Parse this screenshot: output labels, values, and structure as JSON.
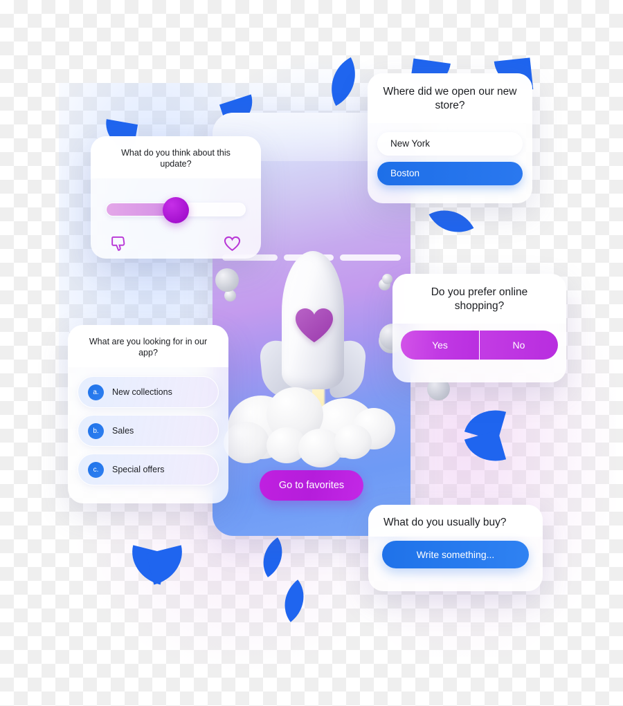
{
  "survey_cards": {
    "slider_card": {
      "question": "What do you think about this update?",
      "slider_value_percent": 50,
      "left_icon": "thumbs-down-icon",
      "right_icon": "heart-icon"
    },
    "store_card": {
      "question": "Where did we open our new store?",
      "options": [
        {
          "label": "New York",
          "selected": false
        },
        {
          "label": "Boston",
          "selected": true
        }
      ]
    },
    "choices_card": {
      "question": "What are you looking for in our app?",
      "options": [
        {
          "badge": "a.",
          "label": "New collections"
        },
        {
          "badge": "b.",
          "label": "Sales"
        },
        {
          "badge": "c.",
          "label": "Special offers"
        }
      ]
    },
    "yesno_card": {
      "question": "Do you prefer online shopping?",
      "yes_label": "Yes",
      "no_label": "No"
    },
    "buy_card": {
      "question": "What do you usually buy?",
      "input_placeholder": "Write something..."
    }
  },
  "phone": {
    "cta_label": "Go to favorites",
    "illustration": "rocket-launch-with-heart"
  },
  "colors": {
    "blue_accent": "#1f65ef",
    "blue_button": "#2570e8",
    "purple_accent": "#b51ddb",
    "magenta_button": "#c139e4",
    "slider_thumb": "#a511cf",
    "heart_purple": "#a84fb8"
  }
}
